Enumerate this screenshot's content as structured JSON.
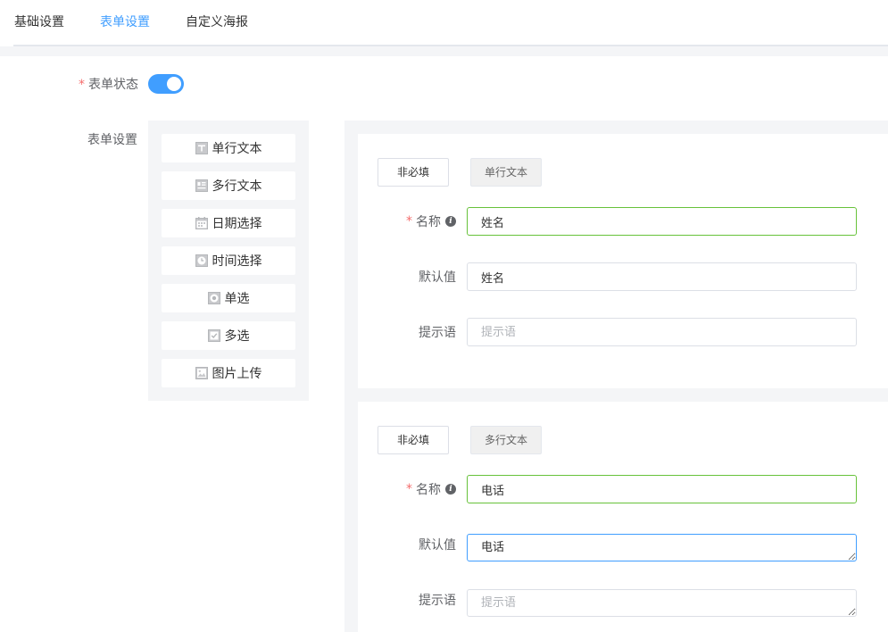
{
  "tabs": [
    {
      "label": "基础设置"
    },
    {
      "label": "表单设置"
    },
    {
      "label": "自定义海报"
    }
  ],
  "form_status": {
    "label": "表单状态",
    "required_mark": "*",
    "enabled": true
  },
  "form_settings_label": "表单设置",
  "palette": [
    {
      "label": "单行文本",
      "icon": "text-field-icon"
    },
    {
      "label": "多行文本",
      "icon": "textarea-icon"
    },
    {
      "label": "日期选择",
      "icon": "calendar-icon"
    },
    {
      "label": "时间选择",
      "icon": "clock-icon"
    },
    {
      "label": "单选",
      "icon": "radio-icon"
    },
    {
      "label": "多选",
      "icon": "checkbox-icon"
    },
    {
      "label": "图片上传",
      "icon": "image-icon"
    }
  ],
  "fields": [
    {
      "required_toggle": "非必填",
      "type_label": "单行文本",
      "name_label": "名称",
      "required_mark": "*",
      "name_value": "姓名",
      "default_label": "默认值",
      "default_value": "姓名",
      "hint_label": "提示语",
      "hint_placeholder": "提示语",
      "hint_value": ""
    },
    {
      "required_toggle": "非必填",
      "type_label": "多行文本",
      "name_label": "名称",
      "required_mark": "*",
      "name_value": "电话",
      "default_label": "默认值",
      "default_value": "电话",
      "hint_label": "提示语",
      "hint_placeholder": "提示语",
      "hint_value": ""
    }
  ],
  "colors": {
    "accent": "#409eff",
    "valid_border": "#67c23a",
    "required": "#f56c6c"
  }
}
